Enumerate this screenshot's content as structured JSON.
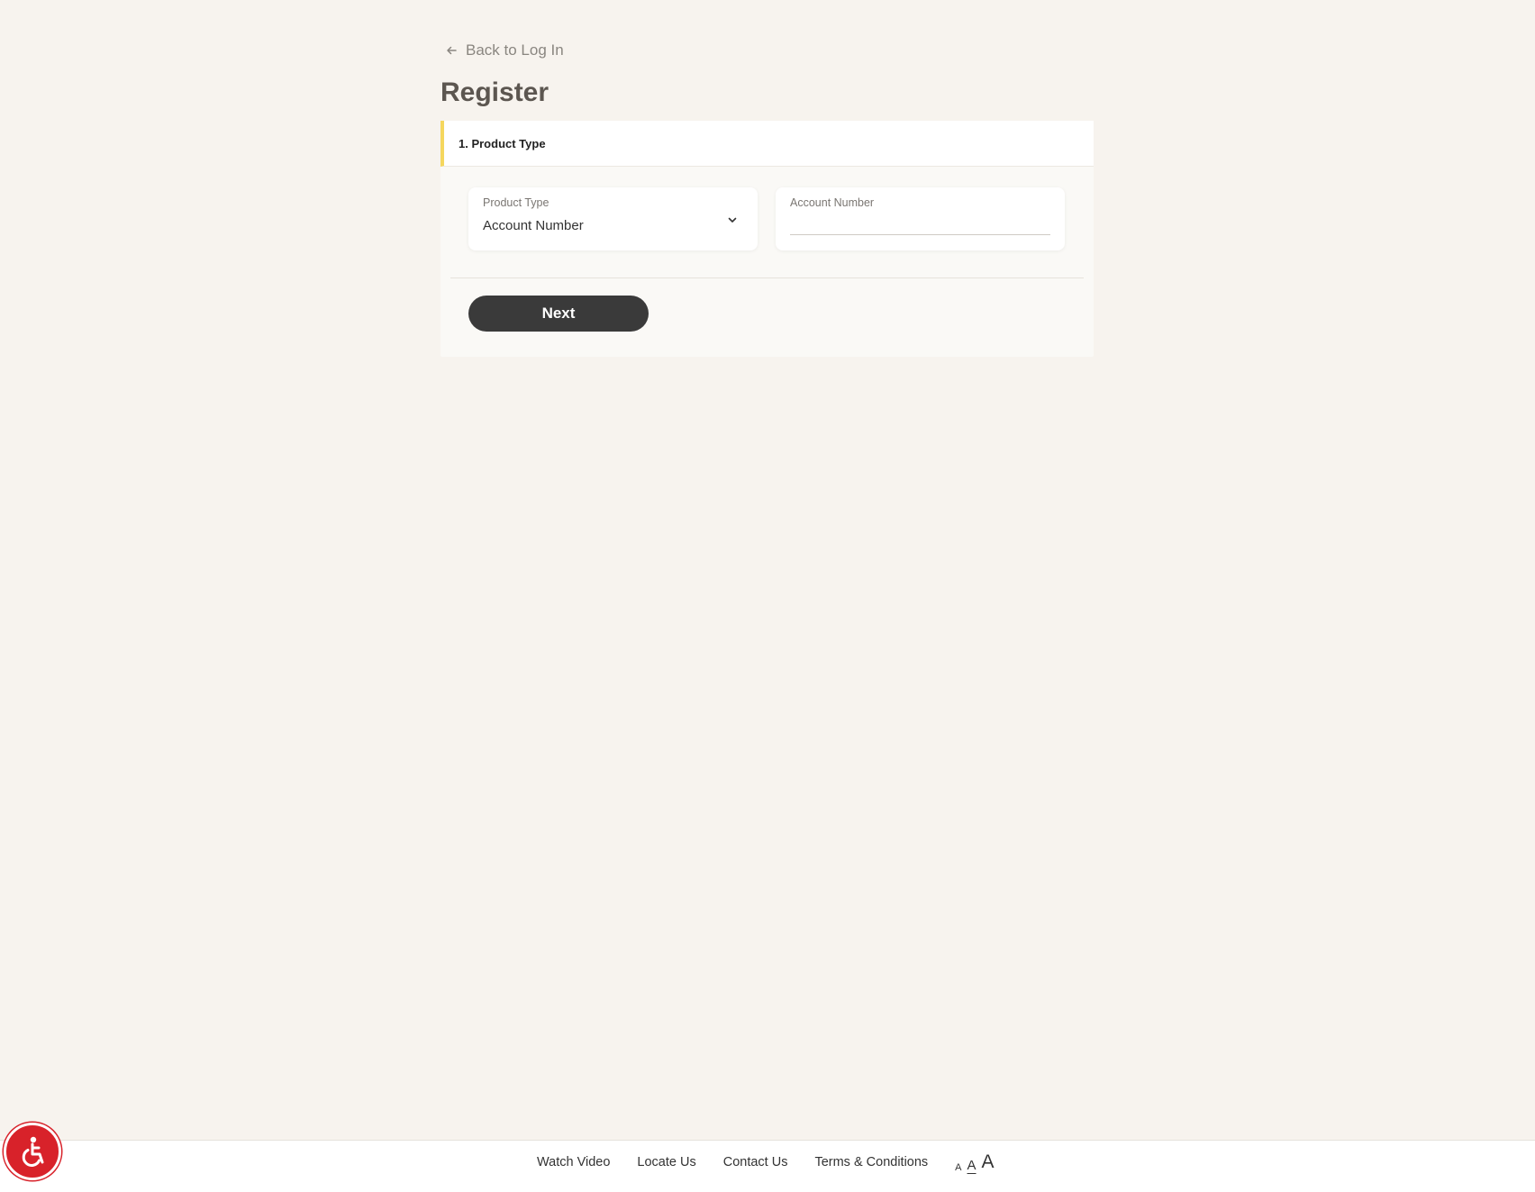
{
  "header": {
    "back_label": "Back to Log In",
    "title": "Register"
  },
  "step": {
    "label": "1. Product Type"
  },
  "form": {
    "product_type": {
      "label": "Product Type",
      "selected": "Account Number"
    },
    "account_number": {
      "label": "Account Number",
      "value": ""
    },
    "next_label": "Next"
  },
  "footer": {
    "links": [
      "Watch Video",
      "Locate Us",
      "Contact Us",
      "Terms & Conditions"
    ],
    "font_sizes": [
      "A",
      "A",
      "A"
    ]
  },
  "icons": {
    "back": "arrow-left-icon",
    "dropdown": "chevron-down-icon",
    "accessibility": "accessibility-icon"
  },
  "colors": {
    "background": "#f7f3ee",
    "step_accent": "#f5d75e",
    "button": "#3a3a3a",
    "accessibility": "#d8222a"
  }
}
